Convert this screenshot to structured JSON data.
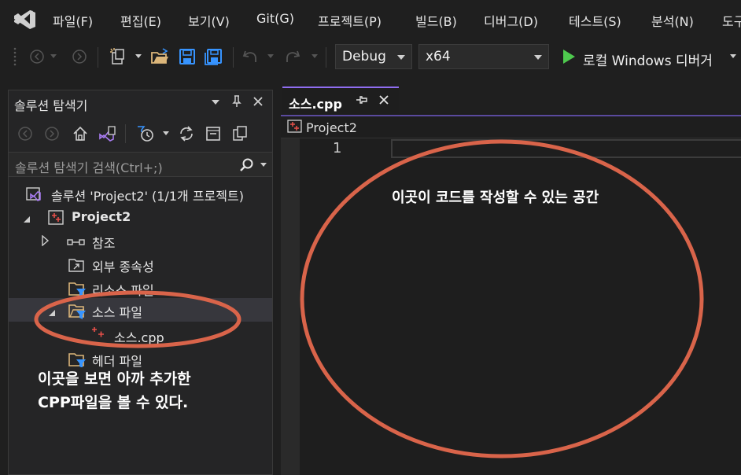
{
  "menu": {
    "items": [
      "파일(F)",
      "편집(E)",
      "보기(V)",
      "Git(G)",
      "프로젝트(P)",
      "빌드(B)",
      "디버그(D)",
      "테스트(S)",
      "분석(N)",
      "도구"
    ]
  },
  "toolbar": {
    "config": "Debug",
    "platform": "x64",
    "run_label": "로컬 Windows 디버거"
  },
  "solution_explorer": {
    "title": "솔루션 탐색기",
    "search_placeholder": "솔루션 탐색기 검색(Ctrl+;)",
    "solution_label": "솔루션 'Project2' (1/1개 프로젝트)",
    "project_label": "Project2",
    "items": {
      "references": "참조",
      "external_deps": "외부 종속성",
      "resource_files": "리소스 파일",
      "source_files": "소스 파일",
      "source_cpp": "소스.cpp",
      "header_files": "헤더 파일"
    }
  },
  "editor": {
    "tab_title": "소스.cpp",
    "nav_project": "Project2",
    "line_number": "1"
  },
  "annotations": {
    "editor_note": "이곳이 코드를 작성할 수 있는 공간",
    "explorer_note_line1": "이곳을 보면 아까 추가한",
    "explorer_note_line2": "CPP파일을 볼 수 있다."
  },
  "colors": {
    "accent": "#8f6df0",
    "highlight_circle": "#d9644a",
    "run_green": "#4ec94e",
    "save_blue": "#3794ff",
    "folder_yellow": "#dcb67a"
  }
}
